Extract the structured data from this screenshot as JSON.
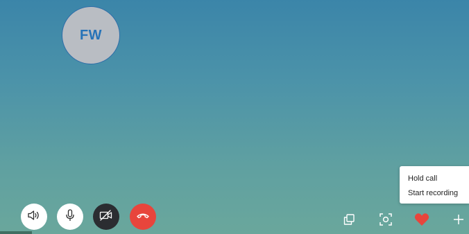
{
  "participant": {
    "initials": "FW"
  },
  "controls": {
    "speaker_icon": "speaker-icon",
    "mic_icon": "microphone-icon",
    "video_icon": "video-off-icon",
    "hangup_icon": "hang-up-icon"
  },
  "tools": {
    "windows_icon": "switch-windows-icon",
    "snapshot_icon": "snapshot-icon",
    "react_icon": "heart-icon",
    "more_icon": "plus-icon"
  },
  "menu": {
    "hold_call": "Hold call",
    "start_recording": "Start recording"
  },
  "colors": {
    "hangup": "#e8453c",
    "heart": "#e8453c",
    "avatar_text": "#2673b8",
    "video_button": "#2b2d31"
  }
}
